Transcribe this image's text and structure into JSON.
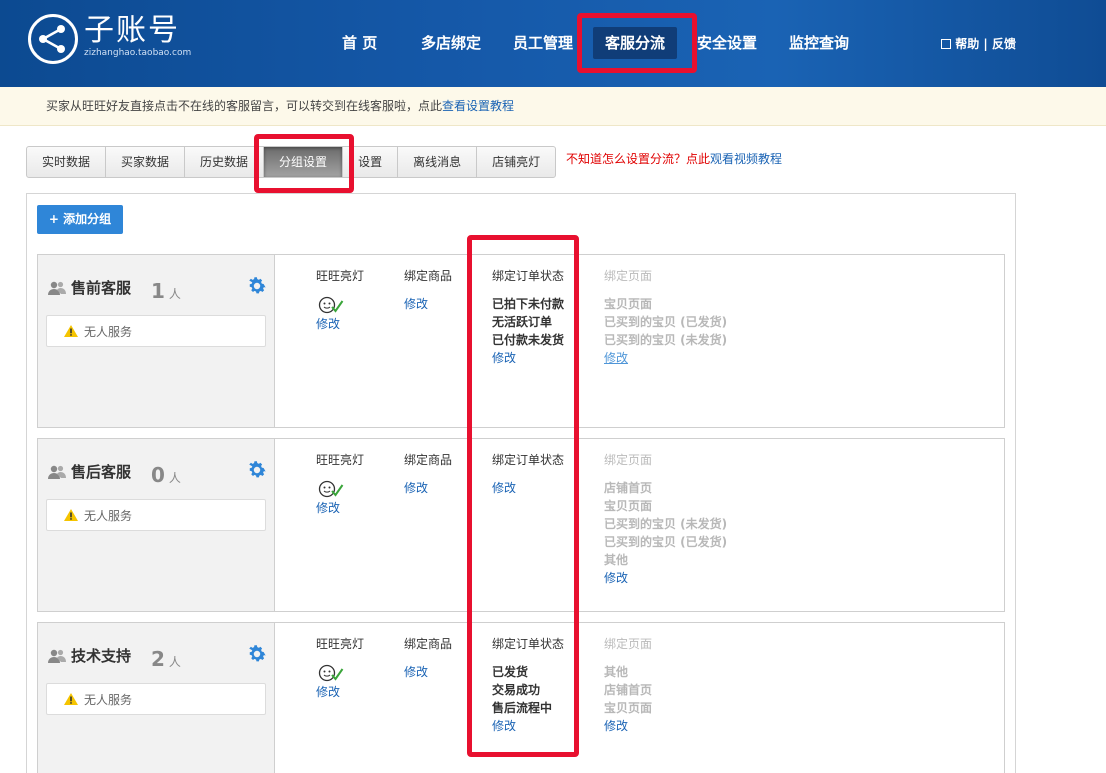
{
  "header": {
    "logo_title": "子账号",
    "logo_sub": "zizhanghao.taobao.com",
    "nav": [
      {
        "label": "首 页"
      },
      {
        "label": "多店绑定"
      },
      {
        "label": "员工管理"
      },
      {
        "label": "客服分流",
        "active": true
      },
      {
        "label": "安全设置"
      },
      {
        "label": "监控查询"
      }
    ],
    "help": "帮助 | 反馈"
  },
  "notice": {
    "text": "买家从旺旺好友直接点击不在线的客服留言，可以转交到在线客服啦，点此",
    "link": "查看设置教程"
  },
  "tabs": [
    {
      "label": "实时数据"
    },
    {
      "label": "买家数据"
    },
    {
      "label": "历史数据"
    },
    {
      "label": "分组设置",
      "active": true
    },
    {
      "label": "设置"
    },
    {
      "label": "离线消息"
    },
    {
      "label": "店铺亮灯"
    }
  ],
  "tab_hint": {
    "text": "不知道怎么设置分流？点此",
    "link": "观看视频教程"
  },
  "add_button": "+ 添加分组",
  "column_headers": {
    "ww": "旺旺亮灯",
    "goods": "绑定商品",
    "order": "绑定订单状态",
    "page": "绑定页面"
  },
  "edit_label": "修改",
  "groups": [
    {
      "name": "售前客服",
      "count": "1",
      "unit": "人",
      "nobody": "无人服务",
      "order_items": [
        "已拍下未付款",
        "无活跃订单",
        "已付款未发货"
      ],
      "page_items": [
        "宝贝页面",
        "已买到的宝贝 (已发货)",
        "已买到的宝贝 (未发货)"
      ]
    },
    {
      "name": "售后客服",
      "count": "0",
      "unit": "人",
      "nobody": "无人服务",
      "order_items": [],
      "page_items": [
        "店铺首页",
        "宝贝页面",
        "已买到的宝贝 (未发货)",
        "已买到的宝贝 (已发货)",
        "其他"
      ]
    },
    {
      "name": "技术支持",
      "count": "2",
      "unit": "人",
      "nobody": "无人服务",
      "order_items": [
        "已发货",
        "交易成功",
        "售后流程中"
      ],
      "page_items": [
        "其他",
        "店铺首页",
        "宝贝页面"
      ]
    }
  ],
  "colors": {
    "header_blue": "#1558a8",
    "link_blue": "#1a63b4",
    "highlight_red": "#e8102f",
    "button_blue": "#2f86d8"
  }
}
